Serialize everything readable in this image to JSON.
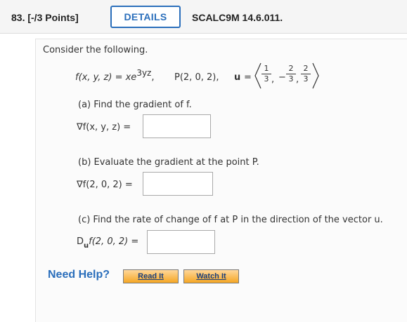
{
  "header": {
    "question_number": "83.",
    "points": "[-/3 Points]",
    "details_label": "DETAILS",
    "course_code": "SCALC9M 14.6.011."
  },
  "problem": {
    "intro": "Consider the following.",
    "function_lhs": "f(x, y, z) = xe",
    "function_exponent": "3yz",
    "point_label": "P(2, 0, 2),",
    "vector_label": "u",
    "vector_components": [
      {
        "sign": "",
        "num": "1",
        "den": "3"
      },
      {
        "sign": "−",
        "num": "2",
        "den": "3"
      },
      {
        "sign": "",
        "num": "2",
        "den": "3"
      }
    ]
  },
  "parts": {
    "a": {
      "prompt": "(a) Find the gradient of f.",
      "label": "∇f(x, y, z) =",
      "answer": ""
    },
    "b": {
      "prompt": "(b) Evaluate the gradient at the point P.",
      "label": "∇f(2, 0, 2) =",
      "answer": ""
    },
    "c": {
      "prompt": "(c) Find the rate of change of f at P in the direction of the vector u.",
      "label_main": "D",
      "label_sub": "u",
      "label_rest": "f(2, 0, 2) =",
      "answer": ""
    }
  },
  "help": {
    "title": "Need Help?",
    "read_it": "Read It",
    "watch_it": "Watch It"
  }
}
